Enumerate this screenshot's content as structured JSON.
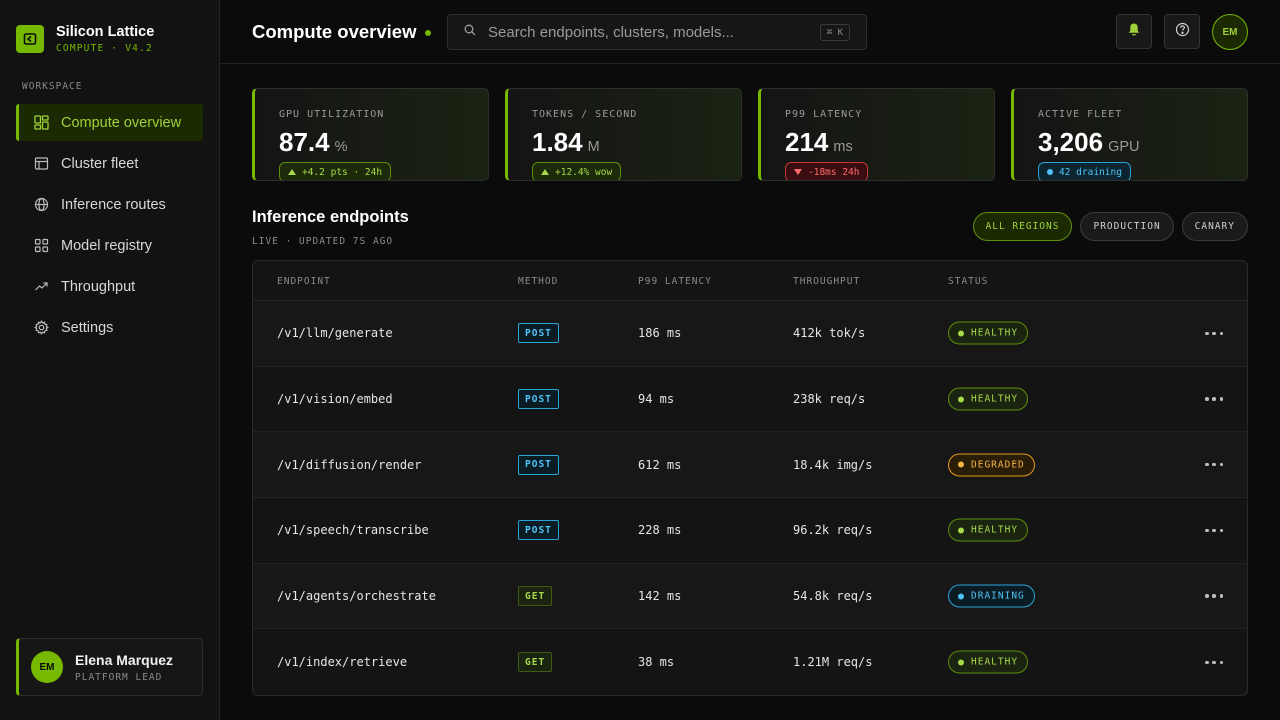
{
  "brand": {
    "name": "Silicon Lattice",
    "subtitle": "COMPUTE · V4.2",
    "logo_icon": "nvidia-style-logo-icon",
    "accent": "#76b900"
  },
  "sidebar": {
    "section_label": "WORKSPACE",
    "items": [
      {
        "label": "Compute overview",
        "icon": "dashboard-grid-icon",
        "active": true
      },
      {
        "label": "Cluster fleet",
        "icon": "table-icon",
        "active": false
      },
      {
        "label": "Inference routes",
        "icon": "globe-icon",
        "active": false
      },
      {
        "label": "Model registry",
        "icon": "apps-grid-icon",
        "active": false
      },
      {
        "label": "Throughput",
        "icon": "trend-up-icon",
        "active": false
      },
      {
        "label": "Settings",
        "icon": "gear-icon",
        "active": false
      }
    ],
    "user": {
      "initials": "EM",
      "name": "Elena Marquez",
      "role": "PLATFORM LEAD"
    }
  },
  "header": {
    "title": "Compute overview",
    "search": {
      "placeholder": "Search endpoints, clusters, models...",
      "shortcut": "⌘ K",
      "icon": "search-icon"
    },
    "actions": {
      "notifications_icon": "bell-icon",
      "help_icon": "help-circle-icon",
      "avatar_initials": "EM"
    }
  },
  "kpis": [
    {
      "label": "GPU UTILIZATION",
      "value": "87.4",
      "unit": "%",
      "badge": "+4.2 pts · 24h",
      "trend": "up"
    },
    {
      "label": "TOKENS / SECOND",
      "value": "1.84",
      "unit": "M",
      "badge": "+12.4% wow",
      "trend": "up"
    },
    {
      "label": "P99 LATENCY",
      "value": "214",
      "unit": "ms",
      "badge": "-18ms 24h",
      "trend": "down"
    },
    {
      "label": "ACTIVE FLEET",
      "value": "3,206",
      "unit": "GPU",
      "badge": "42 draining",
      "trend": "info"
    }
  ],
  "endpoints": {
    "title": "Inference endpoints",
    "subtitle": "LIVE · UPDATED 7S AGO",
    "filters": [
      {
        "label": "ALL REGIONS",
        "active": true
      },
      {
        "label": "PRODUCTION",
        "active": false
      },
      {
        "label": "CANARY",
        "active": false
      }
    ],
    "columns": [
      "ENDPOINT",
      "METHOD",
      "P99 LATENCY",
      "THROUGHPUT",
      "STATUS"
    ],
    "rows": [
      {
        "endpoint": "/v1/llm/generate",
        "method": "POST",
        "latency": "186 ms",
        "throughput": "412k tok/s",
        "status": "HEALTHY"
      },
      {
        "endpoint": "/v1/vision/embed",
        "method": "POST",
        "latency": "94 ms",
        "throughput": "238k req/s",
        "status": "HEALTHY"
      },
      {
        "endpoint": "/v1/diffusion/render",
        "method": "POST",
        "latency": "612 ms",
        "throughput": "18.4k img/s",
        "status": "DEGRADED"
      },
      {
        "endpoint": "/v1/speech/transcribe",
        "method": "POST",
        "latency": "228 ms",
        "throughput": "96.2k req/s",
        "status": "HEALTHY"
      },
      {
        "endpoint": "/v1/agents/orchestrate",
        "method": "GET",
        "latency": "142 ms",
        "throughput": "54.8k req/s",
        "status": "DRAINING"
      },
      {
        "endpoint": "/v1/index/retrieve",
        "method": "GET",
        "latency": "38 ms",
        "throughput": "1.21M req/s",
        "status": "HEALTHY"
      }
    ]
  }
}
